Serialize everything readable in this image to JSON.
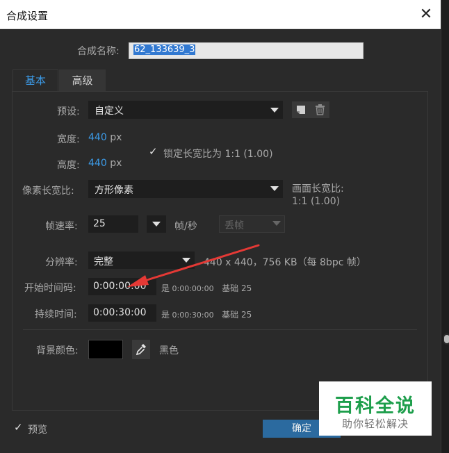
{
  "window": {
    "title": "合成设置",
    "close": "✕"
  },
  "composition": {
    "name_label": "合成名称:",
    "name_value": "62_133639_3"
  },
  "tabs": [
    {
      "label": "基本",
      "active": true
    },
    {
      "label": "高级",
      "active": false
    }
  ],
  "basic": {
    "preset_label": "预设:",
    "preset_value": "自定义",
    "width_label": "宽度:",
    "width_value": "440",
    "height_label": "高度:",
    "height_value": "440",
    "unit_px": "px",
    "lock_checked": true,
    "lock_label": "锁定长宽比为 1:1 (1.00)",
    "pixel_aspect_label": "像素长宽比:",
    "pixel_aspect_value": "方形像素",
    "frame_aspect_label": "画面长宽比:",
    "frame_aspect_value": "1:1 (1.00)",
    "fps_label": "帧速率:",
    "fps_value": "25",
    "fps_unit": "帧/秒",
    "drop_frame_value": "丢帧",
    "resolution_label": "分辨率:",
    "resolution_value": "完整",
    "resolution_info": "440 x 440，756 KB（每 8bpc 帧）",
    "start_tc_label": "开始时间码:",
    "start_tc_value": "0:00:00:00",
    "start_tc_info_prefix": "是",
    "start_tc_info": "0:00:00:00",
    "base_label": "基础 25",
    "duration_label": "持续时间:",
    "duration_value": "0:00:30:00",
    "duration_info_prefix": "是",
    "duration_info": "0:00:30:00",
    "bg_color_label": "背景颜色:",
    "bg_color_name": "黑色",
    "bg_color_hex": "#000000"
  },
  "footer": {
    "preview_checked": true,
    "preview_label": "预览",
    "ok_label": "确定"
  },
  "watermark": {
    "title": "百科全说",
    "subtitle": "助你轻松解决"
  },
  "colors": {
    "accent_blue": "#3c9be8",
    "ok_button": "#2b6a9f",
    "annotation_arrow": "#e53935",
    "watermark_green": "#1d9e4b"
  },
  "icons": [
    "close-icon",
    "dropdown-arrow-icon",
    "save-preset-icon",
    "trash-icon",
    "checkmark-icon",
    "eyedropper-icon"
  ]
}
